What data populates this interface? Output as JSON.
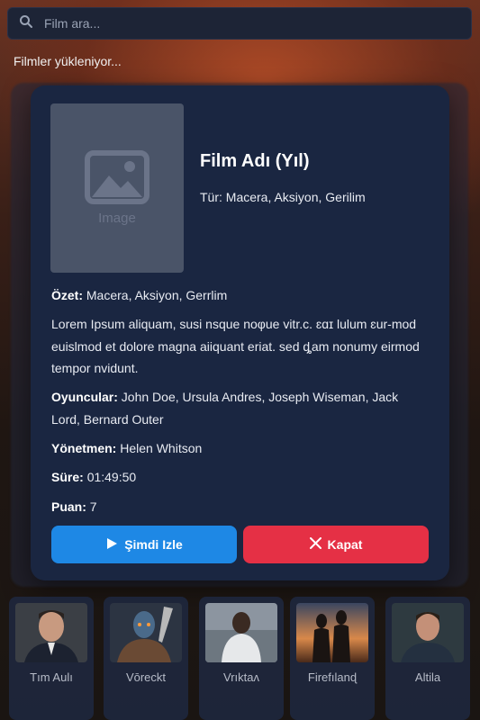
{
  "search": {
    "placeholder": "Film ara..."
  },
  "status": {
    "loading_text": "Filmler yükleniyor..."
  },
  "modal": {
    "poster_placeholder": "Image",
    "title": "Film Adı (Yıl)",
    "genre": "Tür: Macera, Aksiyon, Gerilim",
    "summary_label": "Özet:",
    "summary_genre": "Macera, Aksiyon, Gerrlim",
    "description": "Lorem Ipsum aliquam, susi nsque noφue vitr.c. ɛɑɪ lulum ɛur-mod euislmod et dolore magna aiiquant eriat. sed ȡam nonumy eirmod tempor nvidunt.",
    "cast_label": "Oyuncular:",
    "cast": "John Doe, Ursula Andres, Joseph Wiseman, Jack Lord, Bernard Outer",
    "director_label": "Yönetmen:",
    "director": "Helen Whitson",
    "duration_label": "Süre:",
    "duration": "01:49:50",
    "rating_label": "Puan:",
    "rating": "7",
    "watch_button": "Şimdi Izle",
    "close_button": "Kapat"
  },
  "movies": [
    {
      "name": "Tım Aulı"
    },
    {
      "name": "Vōreckt"
    },
    {
      "name": "Vrıktaʌ"
    },
    {
      "name": "Firefılanɖ"
    },
    {
      "name": "Altila"
    }
  ],
  "colors": {
    "accent_blue": "#1e88e5",
    "accent_red": "#e53045",
    "modal_bg": "#1a2641"
  },
  "icons": {
    "search": "search-icon",
    "image_placeholder": "image-icon",
    "play": "play-icon",
    "close": "close-icon"
  }
}
